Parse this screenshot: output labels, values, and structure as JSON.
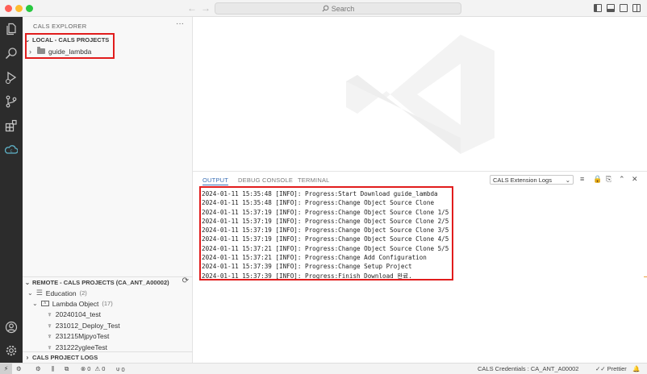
{
  "titlebar": {
    "search_placeholder": "Search",
    "back_icon": "arrow-left-icon",
    "forward_icon": "arrow-right-icon"
  },
  "activity_bar": {
    "items": [
      "explorer-icon",
      "search-icon",
      "run-debug-icon",
      "source-control-icon",
      "extensions-icon",
      "cals-icon"
    ],
    "bottom": [
      "account-icon",
      "gear-icon"
    ]
  },
  "sidebar": {
    "title": "CALS EXPLORER",
    "more": "···",
    "local": {
      "header": "LOCAL - CALS PROJECTS",
      "items": [
        {
          "label": "guide_lambda"
        }
      ]
    },
    "remote": {
      "header": "REMOTE - CALS PROJECTS (CA_ANT_A00002)",
      "education": {
        "label": "Education",
        "count": "(2)"
      },
      "lambda": {
        "label": "Lambda Object",
        "count": "(17)"
      },
      "items": [
        "20240104_test",
        "231012_Deploy_Test",
        "231215MjpyoTest",
        "231222ygleeTest"
      ]
    },
    "logs_header": "CALS PROJECT LOGS"
  },
  "panel": {
    "tabs": [
      "OUTPUT",
      "DEBUG CONSOLE",
      "TERMINAL"
    ],
    "active_tab": "OUTPUT",
    "channel": "CALS Extension Logs",
    "log_lines": [
      "2024-01-11 15:35:48 [INFO]: Progress:Start Download guide_lambda",
      "2024-01-11 15:35:48 [INFO]: Progress:Change Object Source Clone",
      "2024-01-11 15:37:19 [INFO]: Progress:Change Object Source Clone 1/5",
      "2024-01-11 15:37:19 [INFO]: Progress:Change Object Source Clone 2/5",
      "2024-01-11 15:37:19 [INFO]: Progress:Change Object Source Clone 3/5",
      "2024-01-11 15:37:19 [INFO]: Progress:Change Object Source Clone 4/5",
      "2024-01-11 15:37:21 [INFO]: Progress:Change Object Source Clone 5/5",
      "2024-01-11 15:37:21 [INFO]: Progress:Change Add Configuration",
      "2024-01-11 15:37:39 [INFO]: Progress:Change Setup Project",
      "2024-01-11 15:37:39 [INFO]: Progress:Finish Download 완료."
    ]
  },
  "statusbar": {
    "errors": "0",
    "warnings": "0",
    "ports": "0",
    "credentials": "CALS Credentials : CA_ANT_A00002",
    "prettier": "Prettier"
  },
  "colors": {
    "highlight": "#e11d1d",
    "active_tab": "#3a6fb5",
    "activity_bar": "#2c2c2c"
  }
}
